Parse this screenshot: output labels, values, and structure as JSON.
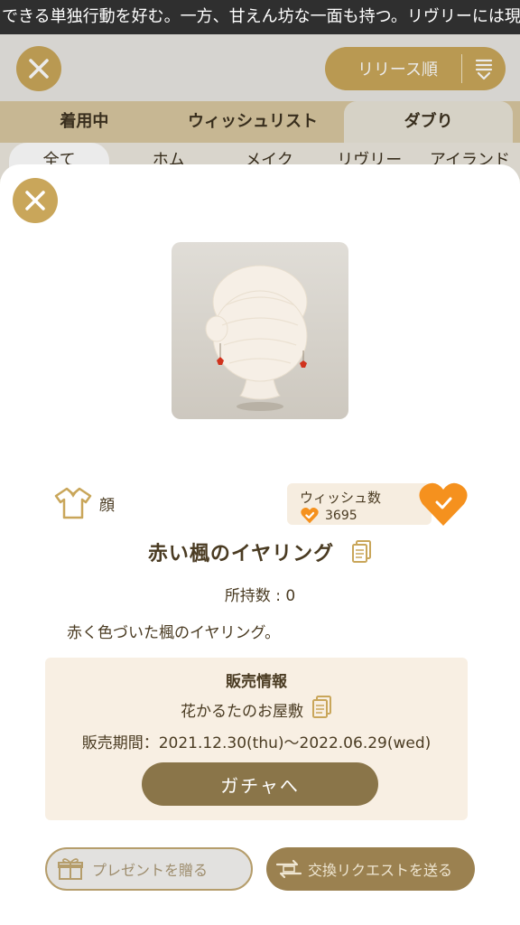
{
  "ticker": {
    "text": "できる単独行動を好む。一方、甘えん坊な一面も持つ。リヴリーには現"
  },
  "topbar": {
    "sort_label": "リリース順"
  },
  "tabs": [
    {
      "label": "着用中"
    },
    {
      "label": "ウィッシュリスト"
    },
    {
      "label": "ダブり"
    }
  ],
  "subtabs": [
    {
      "label": "全て"
    },
    {
      "label": "ホム"
    },
    {
      "label": "メイク"
    },
    {
      "label": "リヴリー"
    },
    {
      "label": "アイランド"
    }
  ],
  "item": {
    "category": "顔",
    "wish_title": "ウィッシュ数",
    "wish_count": "3695",
    "name": "赤い楓のイヤリング",
    "owned": "所持数 : 0",
    "description": "赤く色づいた楓のイヤリング。"
  },
  "sale": {
    "title": "販売情報",
    "shop": "花かるたのお屋敷",
    "period": "販売期間：2021.12.30(thu)～2022.06.29(wed)",
    "gacha_label": "ガチャへ"
  },
  "actions": {
    "present_label": "プレゼントを贈る",
    "exchange_label": "交換リクエストを送る"
  },
  "colors": {
    "gold": "#c9a65a",
    "brown_button": "#8a7549",
    "heart_orange": "#f5911e",
    "sale_bg": "#f8efe3"
  },
  "icons": {
    "close": "close-icon",
    "sort": "sort-icon",
    "category": "shirt-icon",
    "wish": "heart-check-icon",
    "copy": "copy-icon",
    "present": "gift-icon",
    "exchange": "exchange-icon"
  }
}
